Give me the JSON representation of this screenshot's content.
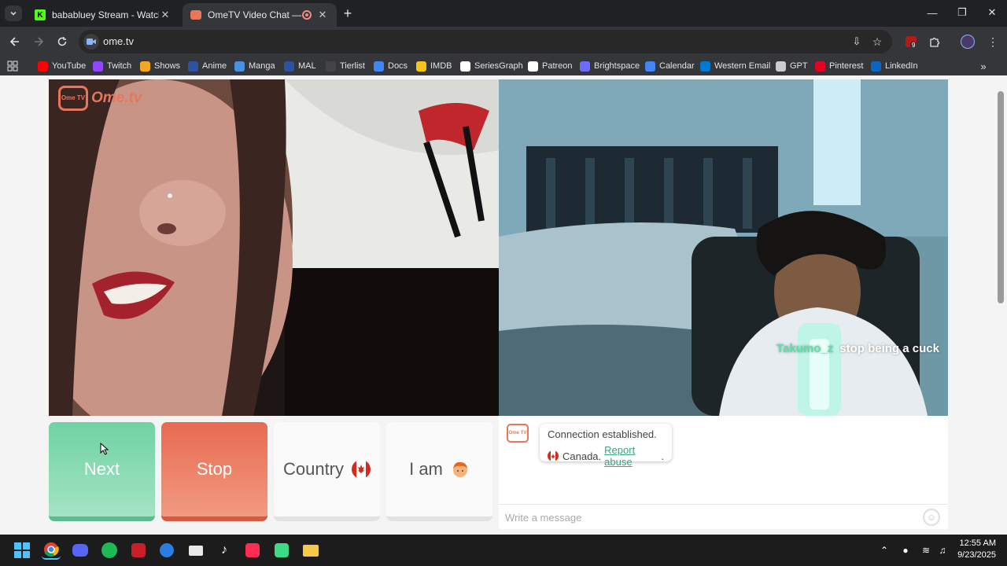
{
  "browser": {
    "tabs": [
      {
        "title": "bababluey Stream - Watch Live",
        "active": false
      },
      {
        "title": "OmeTV Video Chat — Ome",
        "active": true
      }
    ],
    "url": "ome.tv",
    "bookmarks": [
      {
        "label": "YouTube",
        "icon": "youtube-icon",
        "color": "#ff0000"
      },
      {
        "label": "Twitch",
        "icon": "twitch-icon",
        "color": "#9146ff"
      },
      {
        "label": "Shows",
        "icon": "hd-icon",
        "color": "#f5a623"
      },
      {
        "label": "Anime",
        "icon": "anime-icon",
        "color": "#2e51a2"
      },
      {
        "label": "Manga",
        "icon": "manga-icon",
        "color": "#4a90e2"
      },
      {
        "label": "MAL",
        "icon": "mal-icon",
        "color": "#2e51a2"
      },
      {
        "label": "Tierlist",
        "icon": "tierlist-icon",
        "color": "#444444"
      },
      {
        "label": "Docs",
        "icon": "docs-icon",
        "color": "#4285f4"
      },
      {
        "label": "IMDB",
        "icon": "imdb-icon",
        "color": "#f5c518"
      },
      {
        "label": "SeriesGraph",
        "icon": "seriesgraph-icon",
        "color": "#ffffff"
      },
      {
        "label": "Patreon",
        "icon": "patreon-icon",
        "color": "#ffffff"
      },
      {
        "label": "Brightspace",
        "icon": "brightspace-icon",
        "color": "#6c6cff"
      },
      {
        "label": "Calendar",
        "icon": "calendar-icon",
        "color": "#4285f4"
      },
      {
        "label": "Western Email",
        "icon": "outlook-icon",
        "color": "#0078d4"
      },
      {
        "label": "GPT",
        "icon": "chatgpt-icon",
        "color": "#cccccc"
      },
      {
        "label": "Pinterest",
        "icon": "pinterest-icon",
        "color": "#e60023"
      },
      {
        "label": "LinkedIn",
        "icon": "linkedin-icon",
        "color": "#0a66c2"
      }
    ],
    "extensions_badge": "9"
  },
  "page": {
    "logo_text": "Ome.tv",
    "logo_badge": "Ome TV",
    "overlay_chat": {
      "user": "Takumo_z",
      "message": "stop being a cuck"
    },
    "buttons": {
      "next": "Next",
      "stop": "Stop",
      "country": "Country",
      "i_am": "I am"
    },
    "chat": {
      "status": "Connection established.",
      "country": "Canada.",
      "report_link": "Report abuse",
      "report_suffix": ".",
      "input_placeholder": "Write a message"
    },
    "colors": {
      "next": "#6fd3a3",
      "stop": "#e86a52",
      "brand": "#e8765b",
      "link": "#3fa27d"
    }
  },
  "taskbar": {
    "apps": [
      "windows-start-icon",
      "chrome-icon",
      "discord-icon",
      "spotify-icon",
      "app-icon",
      "network-app-icon",
      "mail-icon",
      "tiktok-icon",
      "tiktok-alt-icon",
      "android-studio-icon",
      "file-explorer-icon"
    ],
    "time": "12:55 AM",
    "date": "9/23/2025"
  }
}
